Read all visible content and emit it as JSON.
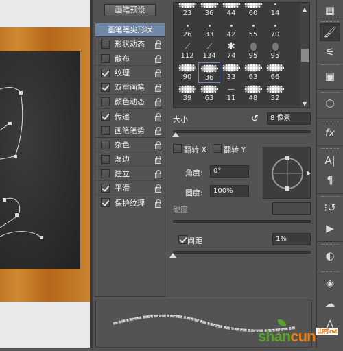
{
  "panel": {
    "preset_button": "画笔预设",
    "list_header": "画笔笔尖形状",
    "items": [
      {
        "label": "形状动态",
        "checked": false
      },
      {
        "label": "散布",
        "checked": false
      },
      {
        "label": "纹理",
        "checked": true
      },
      {
        "label": "双重画笔",
        "checked": true
      },
      {
        "label": "颜色动态",
        "checked": false
      },
      {
        "label": "传递",
        "checked": true
      },
      {
        "label": "画笔笔势",
        "checked": false
      },
      {
        "label": "杂色",
        "checked": false
      },
      {
        "label": "湿边",
        "checked": false
      },
      {
        "label": "建立",
        "checked": false
      },
      {
        "label": "平滑",
        "checked": true
      },
      {
        "label": "保护纹理",
        "checked": true
      }
    ]
  },
  "brush_tips": {
    "rows": [
      [
        "23",
        "36",
        "44",
        "60",
        "14"
      ],
      [
        "26",
        "33",
        "42",
        "55",
        "70"
      ],
      [
        "112",
        "134",
        "74",
        "95",
        "95"
      ],
      [
        "90",
        "36",
        "33",
        "63",
        "66"
      ],
      [
        "39",
        "63",
        "11",
        "48",
        "32"
      ]
    ],
    "selected": {
      "row": 3,
      "col": 1
    }
  },
  "settings": {
    "size_label": "大小",
    "size_value": "8 像素",
    "size_fraction": 0.02,
    "flip_x_label": "翻转 X",
    "flip_y_label": "翻转 Y",
    "flip_x": false,
    "flip_y": false,
    "angle_label": "角度:",
    "angle_value": "0°",
    "roundness_label": "圆度:",
    "roundness_value": "100%",
    "hardness_label": "硬度",
    "hardness_value": "",
    "spacing_label": "间距",
    "spacing_checked": true,
    "spacing_value": "1%",
    "spacing_fraction": 0.0
  },
  "toolbar": {
    "icons": [
      "grid-icon",
      "brush-icon",
      "brush-presets-icon",
      "properties-icon",
      "3d-icon",
      "fx-icon",
      "character-icon",
      "paragraph-icon",
      "history-icon",
      "actions-play-icon",
      "adjustments-icon",
      "layers-icon",
      "channels-icon",
      "paths-icon"
    ]
  },
  "watermark": {
    "part1": "shan",
    "part2": "cun",
    "suffix": "山村.net"
  }
}
